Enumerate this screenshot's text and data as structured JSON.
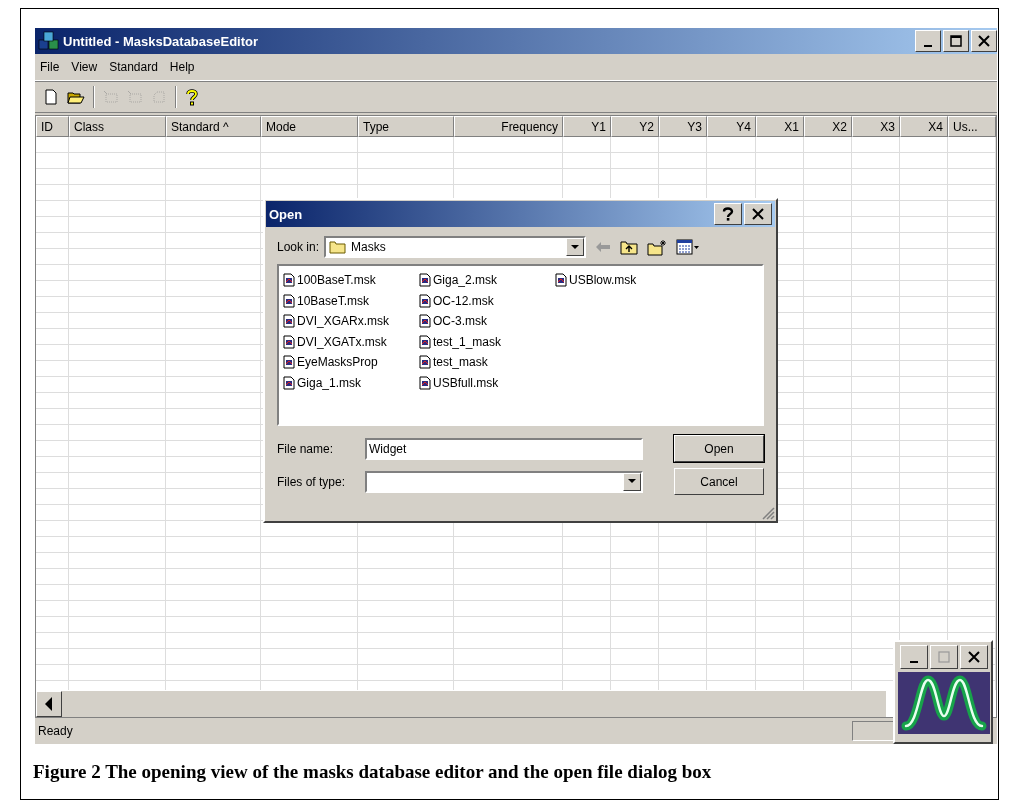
{
  "window": {
    "title": "Untitled - MasksDatabaseEditor"
  },
  "menu": [
    "File",
    "View",
    "Standard",
    "Help"
  ],
  "toolbar": [
    {
      "kind": "new",
      "disabled": false
    },
    {
      "kind": "open",
      "disabled": false
    },
    {
      "kind": "sep"
    },
    {
      "kind": "add",
      "disabled": true
    },
    {
      "kind": "insert",
      "disabled": true
    },
    {
      "kind": "remove",
      "disabled": true
    },
    {
      "kind": "sep"
    },
    {
      "kind": "help",
      "disabled": false
    }
  ],
  "table": {
    "columns": [
      {
        "label": "ID",
        "numeric": false
      },
      {
        "label": "Class",
        "numeric": false
      },
      {
        "label": "Standard ^",
        "numeric": false
      },
      {
        "label": "Mode",
        "numeric": false
      },
      {
        "label": "Type",
        "numeric": false
      },
      {
        "label": "Frequency",
        "numeric": true
      },
      {
        "label": "Y1",
        "numeric": true
      },
      {
        "label": "Y2",
        "numeric": true
      },
      {
        "label": "Y3",
        "numeric": true
      },
      {
        "label": "Y4",
        "numeric": true
      },
      {
        "label": "X1",
        "numeric": true
      },
      {
        "label": "X2",
        "numeric": true
      },
      {
        "label": "X3",
        "numeric": true
      },
      {
        "label": "X4",
        "numeric": true
      },
      {
        "label": "Us...",
        "numeric": false
      }
    ]
  },
  "status_bar": "Ready",
  "dialog": {
    "title": "Open",
    "look_in_label": "Look in:",
    "look_in": "Masks",
    "files": [
      "100BaseT.msk",
      "10BaseT.msk",
      "DVI_XGARx.msk",
      "DVI_XGATx.msk",
      "EyeMasksProp",
      "Giga_1.msk",
      "Giga_2.msk",
      "OC-12.msk",
      "OC-3.msk",
      "test_1_mask",
      "test_mask",
      "USBfull.msk",
      "USBlow.msk"
    ],
    "file_name_label": "File name:",
    "file_name": "Widget",
    "file_type_label": "Files of type:",
    "buttons": [
      "Open",
      "Cancel"
    ]
  },
  "caption": "Figure 2 The opening view of the masks database editor and the open file dialog box"
}
